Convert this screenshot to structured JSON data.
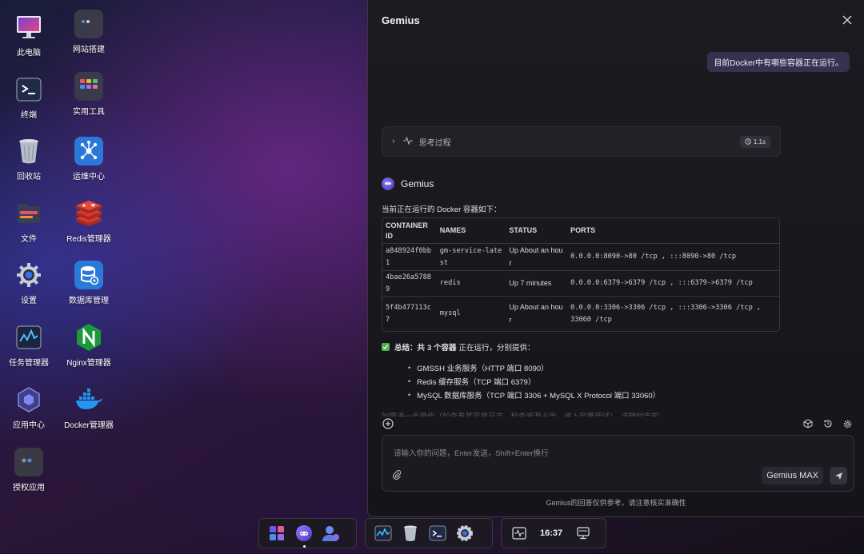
{
  "desktop": {
    "icons": [
      {
        "label": "此电脑",
        "icon": "monitor-icon"
      },
      {
        "label": "网站搭建",
        "icon": "website-builder-icon"
      },
      {
        "label": "终端",
        "icon": "terminal-icon"
      },
      {
        "label": "实用工具",
        "icon": "tools-icon"
      },
      {
        "label": "回收站",
        "icon": "trash-icon"
      },
      {
        "label": "运维中心",
        "icon": "ops-center-icon"
      },
      {
        "label": "文件",
        "icon": "folder-icon"
      },
      {
        "label": "Redis管理器",
        "icon": "redis-icon"
      },
      {
        "label": "设置",
        "icon": "gear-icon"
      },
      {
        "label": "数据库管理",
        "icon": "database-icon"
      },
      {
        "label": "任务管理器",
        "icon": "task-manager-icon"
      },
      {
        "label": "Nginx管理器",
        "icon": "nginx-icon"
      },
      {
        "label": "应用中心",
        "icon": "app-center-icon"
      },
      {
        "label": "Docker管理器",
        "icon": "docker-icon"
      },
      {
        "label": "授权应用",
        "icon": "authorized-apps-icon"
      }
    ]
  },
  "panel": {
    "title": "Gemius",
    "user_message": "目前Docker中有哪些容器正在运行。",
    "thinking": {
      "label": "思考过程",
      "duration": "1.1s"
    },
    "bot_name": "Gemius",
    "intro": "当前正在运行的 Docker 容器如下：",
    "table": {
      "headers": [
        "CONTAINER ID",
        "NAMES",
        "STATUS",
        "PORTS"
      ],
      "rows": [
        {
          "id": "a848924f0bb1",
          "name": "gm-service-latest",
          "status": "Up About an hour",
          "ports": "0.0.0.0:8090->80 /tcp , :::8090->80 /tcp"
        },
        {
          "id": "4bae26a57889",
          "name": "redis",
          "status": "Up 7 minutes",
          "ports": "0.0.0.0:6379->6379 /tcp , :::6379->6379 /tcp"
        },
        {
          "id": "5f4b477113c7",
          "name": "mysql",
          "status": "Up About an hour",
          "ports": "0.0.0.0:3306->3306 /tcp , :::3306->3306 /tcp , 33060 /tcp"
        }
      ]
    },
    "summary": {
      "prefix": "总结：共",
      "count": "3 个容器",
      "suffix": "正在运行，分别提供："
    },
    "bullets": [
      "GMSSH 业务服务（HTTP 端口 8090）",
      "Redis 缓存服务（TCP 端口 6379）",
      "MySQL 数据库服务（TCP 端口 3306 + MySQL X Protocol 端口 33060）"
    ],
    "trailing_text": "如需进一步操作（如查看某容器日志、检查资源占用、进入容器调试），请随时告知。",
    "input": {
      "placeholder": "请输入你的问题，Enter发送，Shift+Enter换行",
      "value": ""
    },
    "model_label": "Gemius MAX",
    "disclaimer": "Gemius的回答仅供参考，请注意核实准确性"
  },
  "taskbar": {
    "clock": "16:37"
  },
  "colors": {
    "accent": "#8a7dff",
    "check": "#4caf50"
  }
}
